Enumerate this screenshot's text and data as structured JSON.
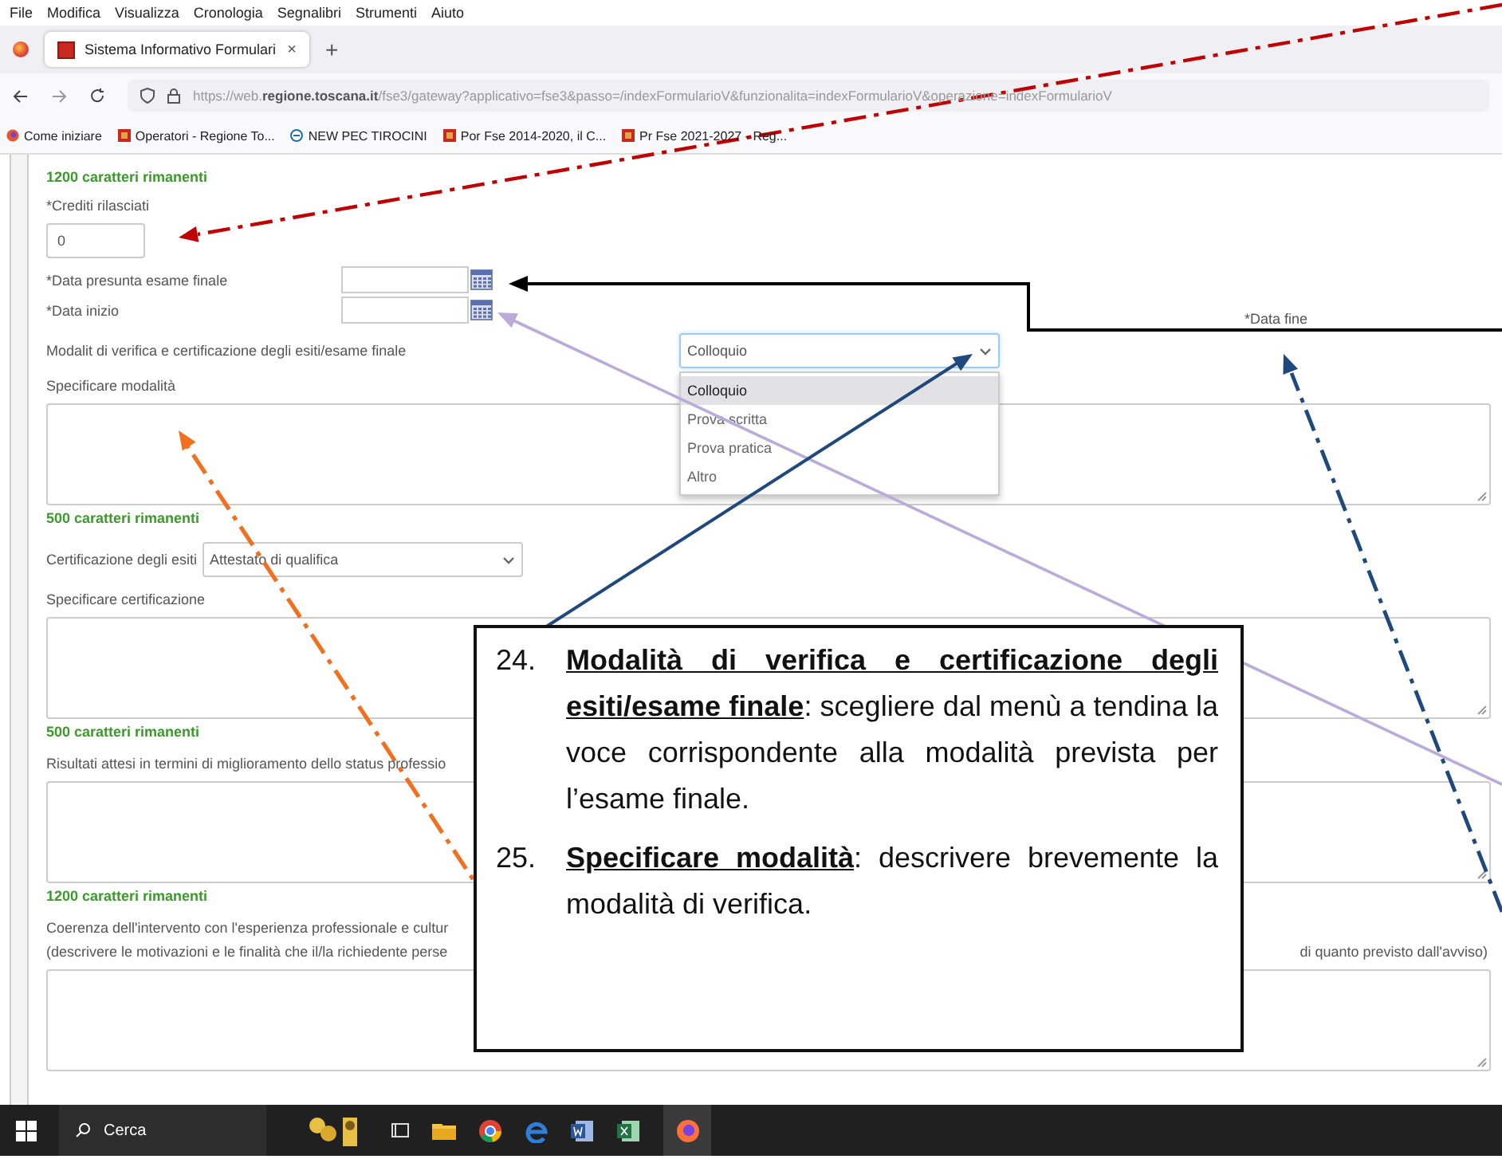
{
  "menu_bar": [
    "File",
    "Modifica",
    "Visualizza",
    "Cronologia",
    "Segnalibri",
    "Strumenti",
    "Aiuto"
  ],
  "browser": {
    "tabs": [
      {
        "title": "Sistema Informativo Formulari",
        "selected": true,
        "close": "×"
      }
    ],
    "new_tab": "+",
    "url": "https://web.**regione.toscana.it**/fse3/gateway?applicativo=fse3&passo=/indexFormularioV&funzionalita=indexFormularioV&operazione=indexFormularioV",
    "bookmarks": [
      {
        "label": "Come iniziare",
        "kind": "start"
      },
      {
        "label": "Operatori - Regione To...",
        "kind": "site"
      },
      {
        "label": "NEW PEC TIROCINI",
        "kind": "web"
      },
      {
        "label": "Por Fse 2014-2020, il C...",
        "kind": "site"
      },
      {
        "label": "Pr Fse 2021-2027 - Reg...",
        "kind": "site"
      }
    ]
  },
  "form": [
    {
      "kind": "counter",
      "text": "1200 caratteri rimanenti"
    },
    {
      "kind": "text_input",
      "label": "*Crediti rilasciati",
      "value": "0"
    },
    {
      "kind": "date",
      "label": "*Data presunta esame finale"
    },
    {
      "kind": "date",
      "label": "*Data inizio",
      "side": {
        "label": "*Data fine"
      }
    },
    {
      "kind": "select",
      "label": "Modalit di verifica e certificazione degli esiti/esame finale",
      "value": "Colloquio",
      "inline": false,
      "open": true,
      "options": [
        {
          "label": "Colloquio",
          "selected": true
        },
        {
          "label": "Prova scritta",
          "selected": false
        },
        {
          "label": "Prova pratica",
          "selected": false
        },
        {
          "label": "Altro",
          "selected": false
        }
      ]
    },
    {
      "kind": "textarea",
      "lines": [
        {
          "text": "Specificare modalità"
        }
      ]
    },
    {
      "kind": "counter",
      "text": "500 caratteri rimanenti"
    },
    {
      "kind": "select",
      "label": "Certificazione degli esiti",
      "value": "Attestato di qualifica",
      "inline": true,
      "open": false
    },
    {
      "kind": "textarea",
      "lines": [
        {
          "text": "Specificare certificazione"
        }
      ]
    },
    {
      "kind": "counter",
      "text": "500 caratteri rimanenti"
    },
    {
      "kind": "textarea",
      "lines": [
        {
          "text": "Risultati attesi in termini di miglioramento dello status professio"
        }
      ]
    },
    {
      "kind": "counter",
      "text": "1200 caratteri rimanenti"
    },
    {
      "kind": "textarea",
      "lines": [
        {
          "text": "Coerenza dell'intervento con l'esperienza professionale e cultur"
        },
        {
          "text": "(descrivere le motivazioni e le finalità che il/la richiedente perse",
          "tail": "di quanto previsto dall'avviso)"
        }
      ]
    }
  ],
  "callout": [
    {
      "number": "24.",
      "text": "**Modalità di verifica e certificazione degli esiti/esame finale**: scegliere dal menù a tendina la voce corrispondente alla modalità prevista per l’esame finale."
    },
    {
      "number": "25.",
      "text": "**Specificare modalità**: descrivere brevemente la modalità di verifica."
    }
  ],
  "taskbar": {
    "search": {
      "placeholder": "Cerca"
    }
  }
}
